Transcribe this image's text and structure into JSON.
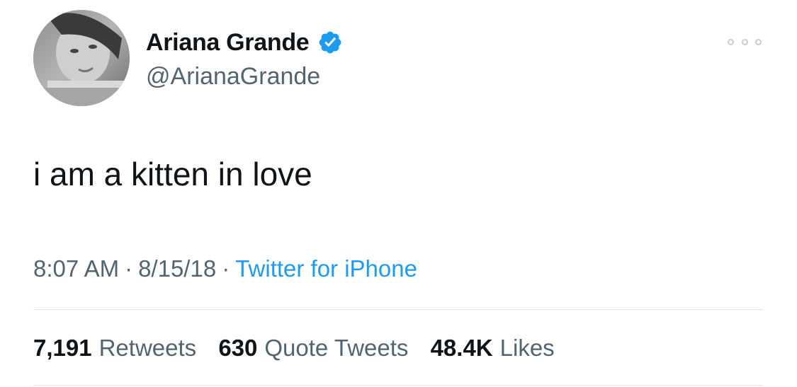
{
  "author": {
    "name": "Ariana Grande",
    "handle": "@ArianaGrande",
    "verified": true
  },
  "tweet": {
    "text": "i am a kitten in love",
    "time": "8:07 AM",
    "date": "8/15/18",
    "separator": "·",
    "source": "Twitter for iPhone"
  },
  "stats": {
    "retweets_count": "7,191",
    "retweets_label": "Retweets",
    "quotes_count": "630",
    "quotes_label": "Quote Tweets",
    "likes_count": "48.4K",
    "likes_label": "Likes"
  },
  "colors": {
    "accent": "#1d9bf0",
    "secondary_text": "#536471",
    "primary_text": "#0f1419",
    "divider": "#e1e6ea"
  },
  "icons": {
    "verified": "verified-badge-icon",
    "more": "more-options-icon"
  }
}
